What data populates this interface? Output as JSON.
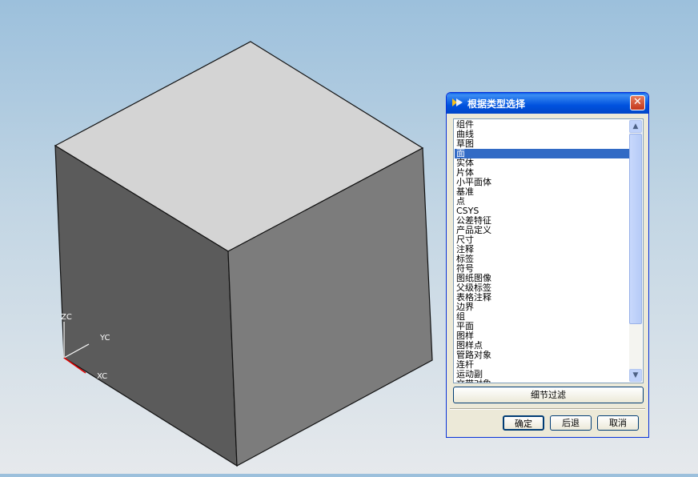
{
  "viewport": {
    "triad": {
      "zc_label": "ZC",
      "yc_label": "YC",
      "xc_label": "XC"
    },
    "colors": {
      "top_face": "#d4d4d4",
      "left_face": "#5b5b5b",
      "right_face": "#7c7c7c",
      "edge": "#111111"
    }
  },
  "dialog": {
    "title": "根据类型选择",
    "close_label": "✕",
    "items": [
      "组件",
      "曲线",
      "草图",
      "面",
      "实体",
      "片体",
      "小平面体",
      "基准",
      "点",
      "CSYS",
      "公差特征",
      "产品定义",
      "尺寸",
      "注释",
      "标签",
      "符号",
      "图纸图像",
      "父级标签",
      "表格注释",
      "边界",
      "组",
      "平面",
      "图样",
      "图样点",
      "管路对象",
      "连杆",
      "运动副",
      "文带对象"
    ],
    "selected_item": "面",
    "filter_button": "细节过滤",
    "ok_button": "确定",
    "back_button": "后退",
    "cancel_button": "取消",
    "colors": {
      "titlebar": "#0052df",
      "selection": "#316ac5",
      "face": "#ece9d8"
    }
  }
}
